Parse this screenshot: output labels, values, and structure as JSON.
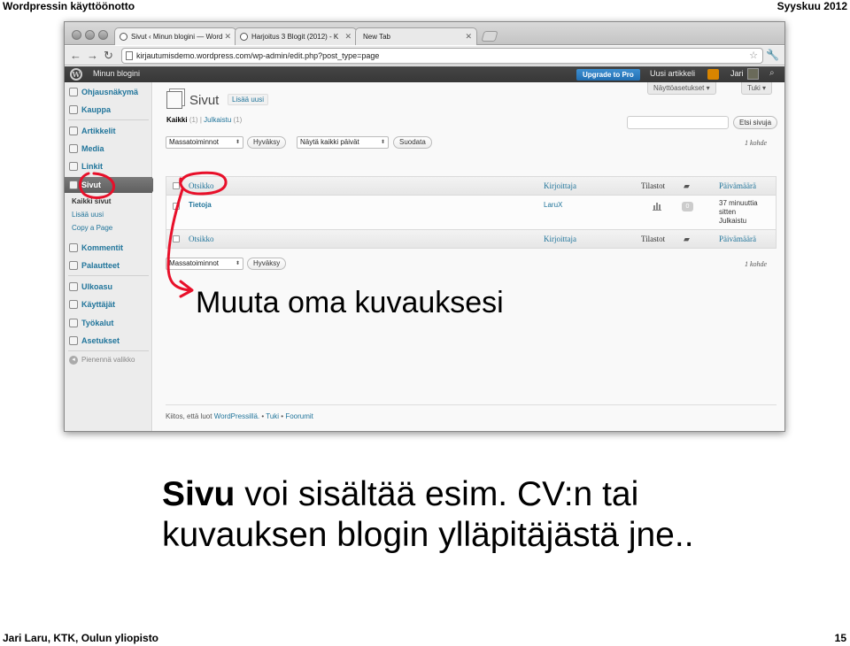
{
  "slide": {
    "header_left": "Wordpressin käyttöönotto",
    "header_right": "Syyskuu 2012",
    "footer_left": "Jari Laru, KTK, Oulun yliopisto",
    "footer_right": "15"
  },
  "browser": {
    "tabs": [
      {
        "label": "Sivut ‹ Minun blogini — Word",
        "icon": "wordpress-favicon",
        "active": true
      },
      {
        "label": "Harjoitus 3 Blogit (2012) - K",
        "icon": "wiki-favicon",
        "active": false
      },
      {
        "label": "New Tab",
        "icon": "none",
        "active": false
      }
    ],
    "url": "kirjautumisdemo.wordpress.com/wp-admin/edit.php?post_type=page"
  },
  "adminbar": {
    "site_name": "Minun blogini",
    "upgrade_label": "Upgrade to Pro",
    "new_label": "Uusi artikkeli",
    "user_label": "Jari"
  },
  "sidebar": {
    "items": [
      {
        "label": "Ohjausnäkymä",
        "icon": "dashboard-icon"
      },
      {
        "label": "Kauppa",
        "icon": "store-icon"
      },
      {
        "label": "Artikkelit",
        "icon": "posts-icon"
      },
      {
        "label": "Media",
        "icon": "media-icon"
      },
      {
        "label": "Linkit",
        "icon": "links-icon"
      },
      {
        "label": "Sivut",
        "icon": "pages-icon"
      },
      {
        "label": "Kommentit",
        "icon": "comments-icon"
      },
      {
        "label": "Palautteet",
        "icon": "feedback-icon"
      },
      {
        "label": "Ulkoasu",
        "icon": "appearance-icon"
      },
      {
        "label": "Käyttäjät",
        "icon": "users-icon"
      },
      {
        "label": "Työkalut",
        "icon": "tools-icon"
      },
      {
        "label": "Asetukset",
        "icon": "settings-icon"
      }
    ],
    "submenu": [
      "Kaikki sivut",
      "Lisää uusi",
      "Copy a Page"
    ],
    "collapse_label": "Pienennä valikko"
  },
  "main": {
    "title": "Sivut",
    "add_new": "Lisää uusi",
    "screen_options": "Näyttöasetukset ▾",
    "help": "Tuki ▾",
    "filter_all": "Kaikki",
    "filter_all_count": "(1)",
    "filter_sep": "|",
    "filter_published": "Julkaistu",
    "filter_published_count": "(1)",
    "search_button": "Etsi sivuja",
    "bulk_actions": "Massatoiminnot",
    "apply": "Hyväksy",
    "date_filter": "Näytä kaikki päivät",
    "filter_button": "Suodata",
    "item_count": "1 kohde",
    "columns": {
      "title": "Otsikko",
      "author": "Kirjoittaja",
      "stats": "Tilastot",
      "date": "Päivämäärä"
    },
    "rows": [
      {
        "title": "Tietoja",
        "author": "LaruX",
        "comments": "0",
        "date_line1": "37 minuuttia",
        "date_line2": "sitten",
        "date_line3": "Julkaistu"
      }
    ],
    "footer_thanks": "Kiitos, että luot ",
    "footer_wp": "WordPressillä.",
    "footer_sep": " • ",
    "footer_support": "Tuki",
    "footer_forums": "Foorumit"
  },
  "annotation": "Muuta oma kuvauksesi",
  "caption": {
    "bold": "Sivu",
    "rest": " voi sisältää esim. CV:n tai kuvauksen blogin ylläpitäjästä jne.."
  },
  "colors": {
    "link": "#21759b",
    "admin_bar": "#464646",
    "upgrade_button": "#2e7fc4",
    "annotation_ink": "#e8102a"
  }
}
